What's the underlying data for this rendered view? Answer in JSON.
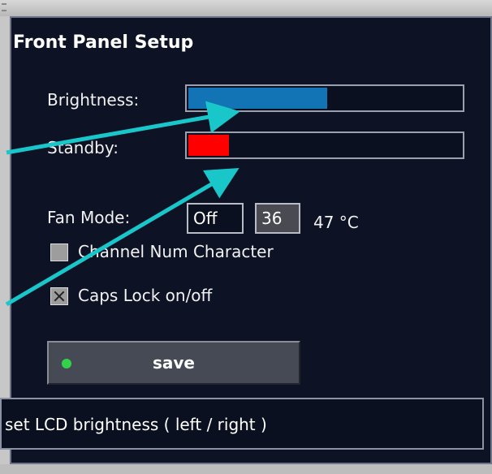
{
  "panel": {
    "title": "Front Panel Setup"
  },
  "brightness": {
    "label": "Brightness:",
    "level_percent": 51,
    "fill_color": "#1273b5"
  },
  "standby": {
    "label": "Standby:",
    "level_percent": 15,
    "fill_color": "#ff0000"
  },
  "fan": {
    "label": "Fan Mode:",
    "mode_value": "Off",
    "setpoint_value": "36",
    "temperature": "47 °C"
  },
  "options": {
    "channel_num_label": "Channel Num Character",
    "channel_num_checked": false,
    "caps_lock_label": "Caps Lock on/off",
    "caps_lock_checked": true
  },
  "save": {
    "label": "save",
    "led_color": "#32d24a"
  },
  "status": {
    "text": "set LCD brightness ( left / right )"
  },
  "colors": {
    "panel_bg": "#0d1224",
    "annotation_arrow": "#19c6c9"
  },
  "icons": [
    "checkbox-icon",
    "led-indicator-icon",
    "annotation-arrow-icon"
  ]
}
